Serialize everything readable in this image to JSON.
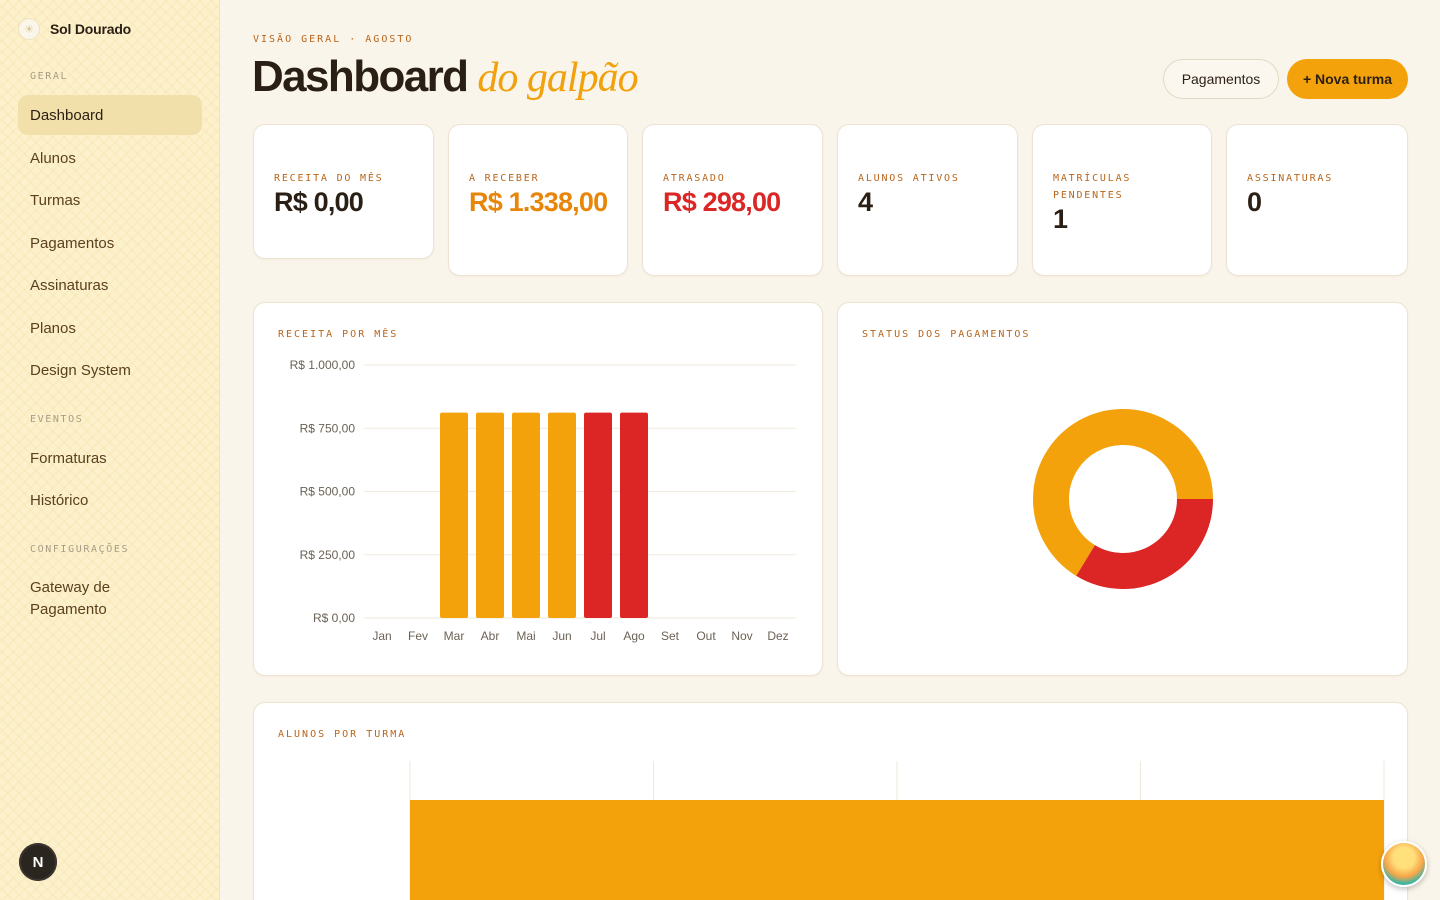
{
  "brand": {
    "name": "Sol Dourado"
  },
  "sidebar": {
    "sections": [
      {
        "label": "GERAL",
        "items": [
          "Dashboard",
          "Alunos",
          "Turmas",
          "Pagamentos",
          "Assinaturas",
          "Planos",
          "Design System"
        ]
      },
      {
        "label": "EVENTOS",
        "items": [
          "Formaturas",
          "Histórico"
        ]
      },
      {
        "label": "CONFIGURAÇÕES",
        "items": [
          "Gateway de Pagamento"
        ]
      }
    ],
    "active": "Dashboard",
    "footer_badge": "N"
  },
  "header": {
    "eyebrow": "VISÃO GERAL · AGOSTO",
    "title": "Dashboard",
    "title_accent": "do galpão",
    "btn_secondary": "Pagamentos",
    "btn_primary": "+ Nova turma"
  },
  "stats": [
    {
      "label": "RECEITA DO MÊS",
      "value": "R$ 0,00",
      "color": "#2a1f14"
    },
    {
      "label": "A RECEBER",
      "value": "R$ 1.338,00",
      "color": "#e8860a"
    },
    {
      "label": "ATRASADO",
      "value": "R$ 298,00",
      "color": "#dc2626"
    },
    {
      "label": "ALUNOS ATIVOS",
      "value": "4",
      "color": "#2a1f14"
    },
    {
      "label": "MATRÍCULAS PENDENTES",
      "value": "1",
      "color": "#2a1f14"
    },
    {
      "label": "ASSINATURAS",
      "value": "0",
      "color": "#2a1f14"
    }
  ],
  "revenue_panel": {
    "title": "RECEITA POR MÊS"
  },
  "status_panel": {
    "title": "STATUS DOS PAGAMENTOS"
  },
  "students_panel": {
    "title": "ALUNOS POR TURMA"
  },
  "colors": {
    "orange": "#f4a20c",
    "red": "#dc2626"
  },
  "chart_data": [
    {
      "type": "bar",
      "title": "RECEITA POR MÊS",
      "categories": [
        "Jan",
        "Fev",
        "Mar",
        "Abr",
        "Mai",
        "Jun",
        "Jul",
        "Ago",
        "Set",
        "Out",
        "Nov",
        "Dez"
      ],
      "series": [
        {
          "color": "#f4a20c",
          "values": [
            0,
            0,
            812,
            812,
            812,
            812,
            0,
            0,
            0,
            0,
            0,
            0
          ]
        },
        {
          "color": "#dc2626",
          "values": [
            0,
            0,
            0,
            0,
            0,
            0,
            812,
            812,
            0,
            0,
            0,
            0
          ]
        }
      ],
      "yticks": [
        "R$ 0,00",
        "R$ 250,00",
        "R$ 500,00",
        "R$ 750,00",
        "R$ 1.000,00"
      ],
      "ylim": [
        0,
        1000
      ],
      "grid": true,
      "legend": "none"
    },
    {
      "type": "pie",
      "title": "STATUS DOS PAGAMENTOS",
      "variant": "donut",
      "slices": [
        {
          "color": "#f4a20c",
          "value": 66.3
        },
        {
          "color": "#dc2626",
          "value": 33.7
        }
      ]
    },
    {
      "type": "bar",
      "title": "ALUNOS POR TURMA",
      "orientation": "horizontal",
      "series": [
        {
          "color": "#f4a20c",
          "values": [
            4
          ]
        }
      ],
      "xlim": [
        0,
        4
      ],
      "grid": true
    }
  ]
}
